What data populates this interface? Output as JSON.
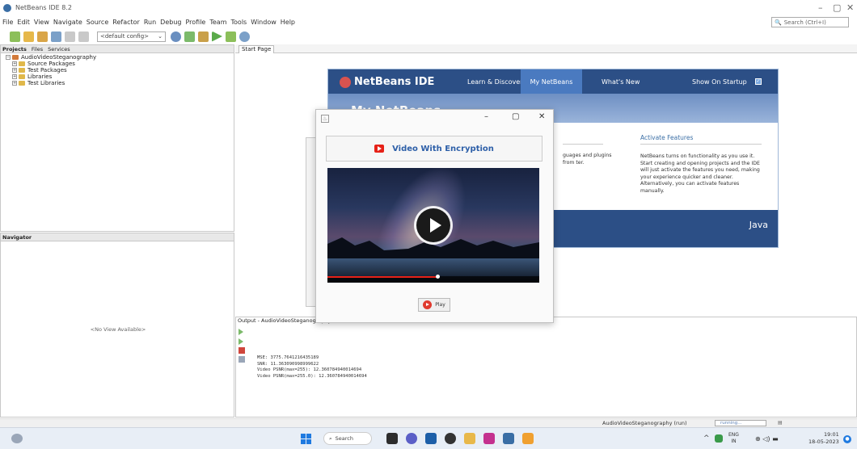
{
  "window": {
    "title": "NetBeans IDE 8.2"
  },
  "menubar": {
    "items": [
      "File",
      "Edit",
      "View",
      "Navigate",
      "Source",
      "Refactor",
      "Run",
      "Debug",
      "Profile",
      "Team",
      "Tools",
      "Window",
      "Help"
    ]
  },
  "search": {
    "placeholder": "Search (Ctrl+I)"
  },
  "toolbar": {
    "config": "<default config>"
  },
  "projects_panel": {
    "tabs": [
      "Projects",
      "Files",
      "Services"
    ],
    "tree": [
      {
        "label": "AudioVideoSteganography",
        "level": 0
      },
      {
        "label": "Source Packages",
        "level": 1
      },
      {
        "label": "Test Packages",
        "level": 1
      },
      {
        "label": "Libraries",
        "level": 1
      },
      {
        "label": "Test Libraries",
        "level": 1
      }
    ]
  },
  "navigator": {
    "tab": "Navigator",
    "empty": "<No View Available>"
  },
  "editor": {
    "tab": "Start Page"
  },
  "start_page": {
    "logo": "NetBeans IDE",
    "nav": [
      "Learn & Discover",
      "My NetBeans",
      "What's New"
    ],
    "show_on_startup": "Show On Startup",
    "banner_title": "My NetBeans",
    "left_text": "guages and plugins from ter.",
    "activate_title": "Activate Features",
    "activate_text": "NetBeans turns on functionality as you use it. Start creating and opening projects and the IDE will just activate the features you need, making your experience quicker and cleaner. Alternatively, you can activate features manually.",
    "java": "Java"
  },
  "popup": {
    "heading": "Video With Encryption",
    "play_label": "Play",
    "video_progress": 0.52
  },
  "output": {
    "tab": "Output - AudioVideoSteganography (run)",
    "lines": [
      "MSE: 3775.7641216435189",
      "SNR: 11.363090998999622",
      "Video PSNR(max=255): 12.360784940014694",
      "Video PSNR(max=255.0): 12.360784940014694"
    ]
  },
  "statusbar": {
    "project": "AudioVideoSteganography (run)",
    "progress": "running..."
  },
  "taskbar": {
    "search": "Search",
    "lang1": "ENG",
    "lang2": "IN",
    "time": "19:01",
    "date": "18-05-2023"
  }
}
